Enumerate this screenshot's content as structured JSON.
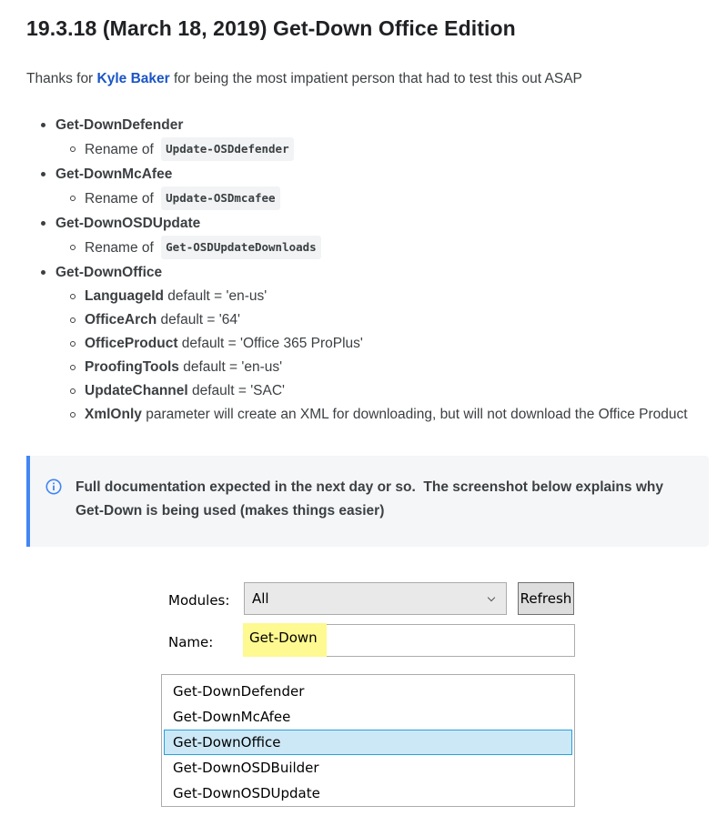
{
  "heading": "19.3.18 (March 18, 2019) Get-Down Office Edition",
  "thanks": {
    "prefix": "Thanks for ",
    "link_text": "Kyle Baker",
    "suffix": " for being the most impatient person that had to test this out ASAP"
  },
  "changes": [
    {
      "name": "Get-DownDefender",
      "sub": [
        {
          "text": "Rename of",
          "code": "Update-OSDdefender"
        }
      ]
    },
    {
      "name": "Get-DownMcAfee",
      "sub": [
        {
          "text": "Rename of",
          "code": "Update-OSDmcafee"
        }
      ]
    },
    {
      "name": "Get-DownOSDUpdate",
      "sub": [
        {
          "text": "Rename of",
          "code": "Get-OSDUpdateDownloads"
        }
      ]
    },
    {
      "name": "Get-DownOffice",
      "params": [
        {
          "param": "LanguageId",
          "desc": " default = 'en-us'"
        },
        {
          "param": "OfficeArch",
          "desc": " default = '64'"
        },
        {
          "param": "OfficeProduct",
          "desc": " default = 'Office 365 ProPlus'"
        },
        {
          "param": "ProofingTools",
          "desc": " default = 'en-us'"
        },
        {
          "param": "UpdateChannel",
          "desc": " default = 'SAC'"
        },
        {
          "param": "XmlOnly",
          "desc": " parameter will create an XML for downloading, but will not download the Office Product"
        }
      ]
    }
  ],
  "info": {
    "icon": "info-icon",
    "text": "Full documentation expected in the next day or so.  The screenshot below explains why Get-Down is being used (makes things easier)",
    "accent_color": "#4285f4"
  },
  "dialog": {
    "modules_label": "Modules:",
    "modules_value": "All",
    "refresh_label": "Refresh",
    "name_label": "Name:",
    "name_value": "Get-Down",
    "highlight_color": "#fef990",
    "results": [
      {
        "label": "Get-DownDefender",
        "selected": false
      },
      {
        "label": "Get-DownMcAfee",
        "selected": false
      },
      {
        "label": "Get-DownOffice",
        "selected": true
      },
      {
        "label": "Get-DownOSDBuilder",
        "selected": false
      },
      {
        "label": "Get-DownOSDUpdate",
        "selected": false
      }
    ]
  }
}
